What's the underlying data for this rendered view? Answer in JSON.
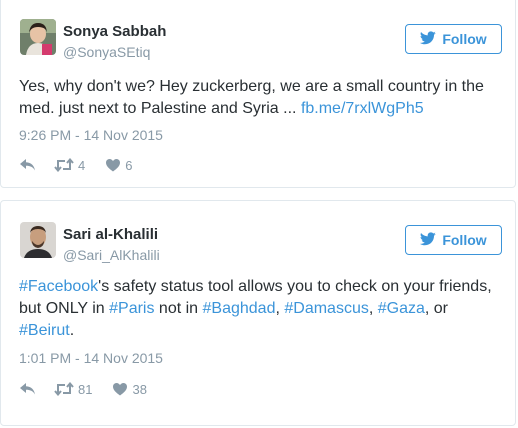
{
  "tweets": [
    {
      "name": "Sonya Sabbah",
      "handle": "@SonyaSEtiq",
      "follow_label": "Follow",
      "text_main": "Yes, why don't we? Hey zuckerberg, we are a small country in the med. just next to Palestine and Syria ...",
      "link": "fb.me/7rxlWgPh5",
      "timestamp": "9:26 PM - 14 Nov 2015",
      "retweets": "4",
      "likes": "6"
    },
    {
      "name": "Sari al-Khalili",
      "handle": "@Sari_AlKhalili",
      "follow_label": "Follow",
      "hashtags": {
        "facebook": "#Facebook",
        "paris": "#Paris",
        "baghdad": "#Baghdad",
        "damascus": "#Damascus",
        "gaza": "#Gaza",
        "beirut": "#Beirut"
      },
      "text_parts": {
        "p1": "'s safety status tool allows you to check on your friends, but ONLY in ",
        "p2": " not in ",
        "p3": ", ",
        "p4": ", ",
        "p5": ", or ",
        "p6": "."
      },
      "timestamp": "1:01 PM - 14 Nov 2015",
      "retweets": "81",
      "likes": "38"
    }
  ],
  "icons": {
    "follow": "twitter-bird-icon",
    "reply": "reply-icon",
    "retweet": "retweet-icon",
    "like": "heart-icon"
  },
  "colors": {
    "link": "#3b94d9",
    "muted": "#8899a6",
    "text": "#292f33",
    "border": "#e1e8ed"
  }
}
